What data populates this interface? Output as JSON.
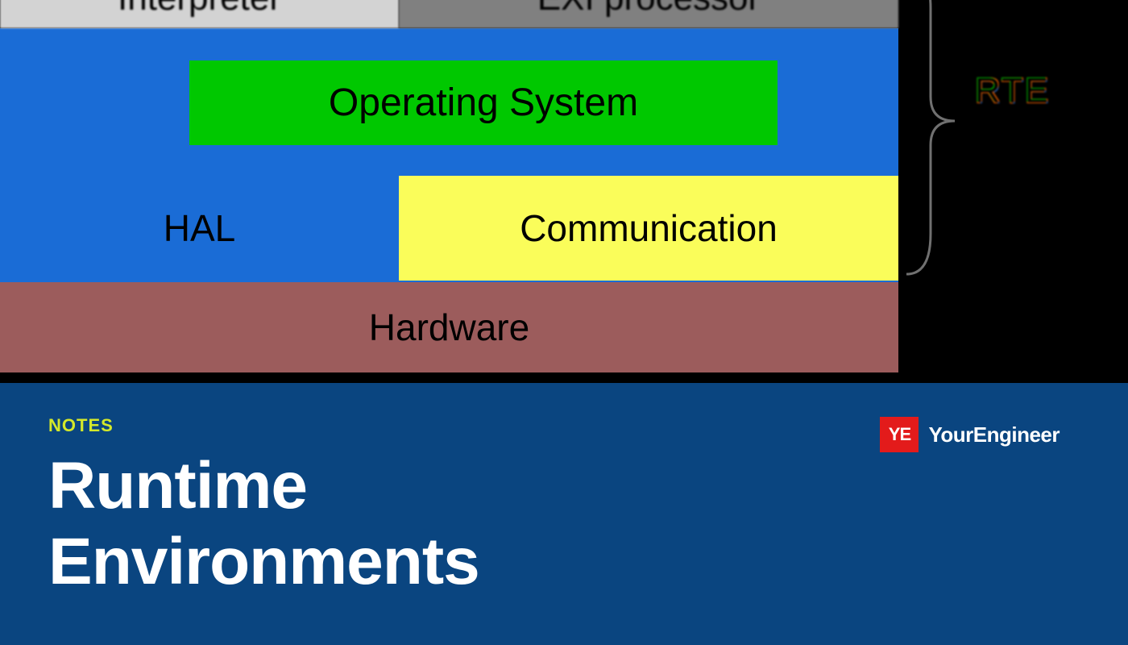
{
  "diagram": {
    "interpreter": "Interpreter",
    "exi": "EXI processor",
    "os": "Operating System",
    "hal": "HAL",
    "communication": "Communication",
    "hardware": "Hardware",
    "rte_label": "RTE"
  },
  "footer": {
    "category": "NOTES",
    "title_line1": "Runtime",
    "title_line2": "Environments"
  },
  "logo": {
    "badge": "YE",
    "text": "YourEngineer"
  },
  "colors": {
    "interpreter_bg": "#d3d3d3",
    "exi_bg": "#808080",
    "blue_bg": "#1a6cd6",
    "os_bg": "#00c800",
    "comm_bg": "#fafd5a",
    "hardware_bg": "#9c5c5c",
    "banner_bg": "#0a4580",
    "notes_color": "#d4e82a",
    "logo_badge_bg": "#e31b1b"
  }
}
